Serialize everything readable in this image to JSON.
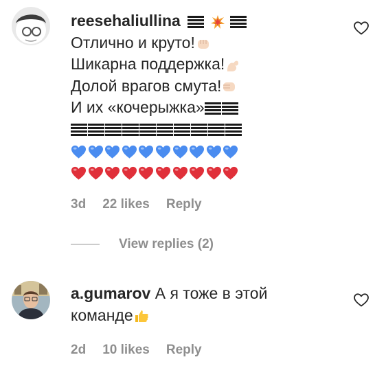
{
  "comments": [
    {
      "username": "reesehaliullina",
      "lines": [
        "Отлично и круто!",
        "Шикарна поддержка!",
        "Долой врагов смута!",
        "И их «кочерыжка»"
      ],
      "blue_hearts_count": 10,
      "red_hearts_count": 10,
      "time": "3d",
      "likes": "22 likes",
      "reply_label": "Reply",
      "emoji": {
        "after_username": [
          "bars-icon",
          "collision-icon",
          "bars-icon"
        ],
        "line1": "fist-icon",
        "line2": "flexed-biceps-icon",
        "line3": "fist-bump-icon",
        "line4": "bars-icon"
      }
    },
    {
      "username": "a.gumarov",
      "lines": [
        "А я тоже в этой",
        "команде"
      ],
      "time": "2d",
      "likes": "10 likes",
      "reply_label": "Reply",
      "emoji": {
        "line2": "thumbs-up-icon"
      }
    }
  ],
  "view_replies_label": "View replies (2)",
  "colors": {
    "text": "#262626",
    "muted": "#8e8e8e",
    "blue_heart": "#4a8cf0",
    "red_heart": "#e0303a"
  }
}
